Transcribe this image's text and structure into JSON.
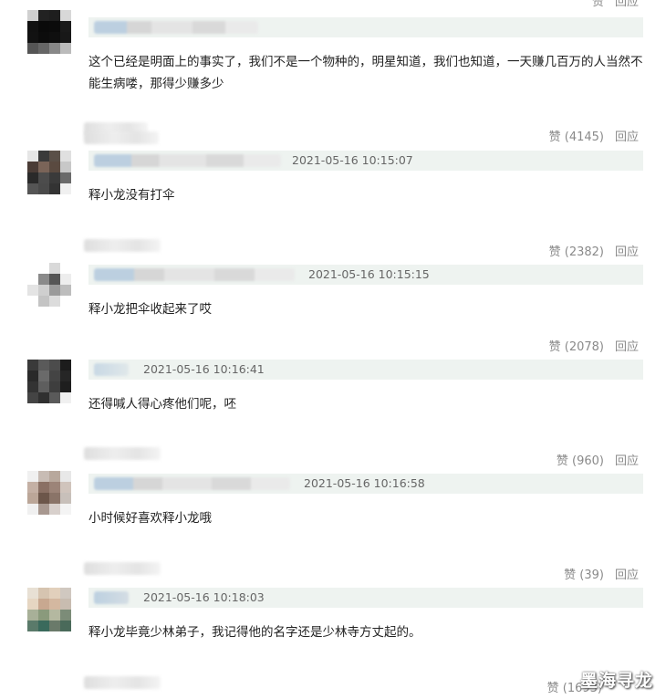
{
  "comments": [
    {
      "date": "",
      "likes": "赞",
      "reply": "回应",
      "text": "这个已经是明面上的事实了，我们不是一个物种的，明星知道，我们也知道，一天赚几百万的人当然不能生病喽，那得少赚多少"
    },
    {
      "date": "2021-05-16 10:15:07",
      "likes": "赞 (4145)",
      "reply": "回应",
      "text": "释小龙没有打伞"
    },
    {
      "date": "2021-05-16 10:15:15",
      "likes": "赞 (2382)",
      "reply": "回应",
      "text": "释小龙把伞收起来了哎"
    },
    {
      "date": "2021-05-16 10:16:41",
      "likes": "赞 (2078)",
      "reply": "回应",
      "text": "还得喊人得心疼他们呢，呸"
    },
    {
      "date": "2021-05-16 10:16:58",
      "likes": "赞 (960)",
      "reply": "回应",
      "text": "小时候好喜欢释小龙哦"
    },
    {
      "date": "2021-05-16 10:18:03",
      "likes": "赞 (39)",
      "reply": "回应",
      "text": "释小龙毕竟少林弟子，我记得他的名字还是少林寺方丈起的。"
    },
    {
      "date": "",
      "likes": "赞 (1693)",
      "reply": "回应",
      "text": ""
    }
  ],
  "watermark": "墨海寻龙",
  "colors": {
    "infobar": "#eef3f0",
    "action_text": "#8a8a8a",
    "date_text": "#666666"
  }
}
